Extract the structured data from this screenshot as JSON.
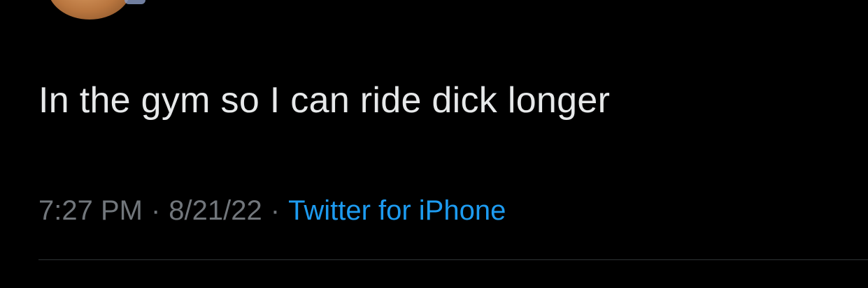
{
  "tweet": {
    "text": "In the gym so I can ride dick longer",
    "time": "7:27 PM",
    "date": "8/21/22",
    "separator": "·",
    "source": "Twitter for iPhone"
  },
  "colors": {
    "background": "#000000",
    "text": "#e7e9ea",
    "meta": "#71767b",
    "link": "#1d9bf0"
  }
}
